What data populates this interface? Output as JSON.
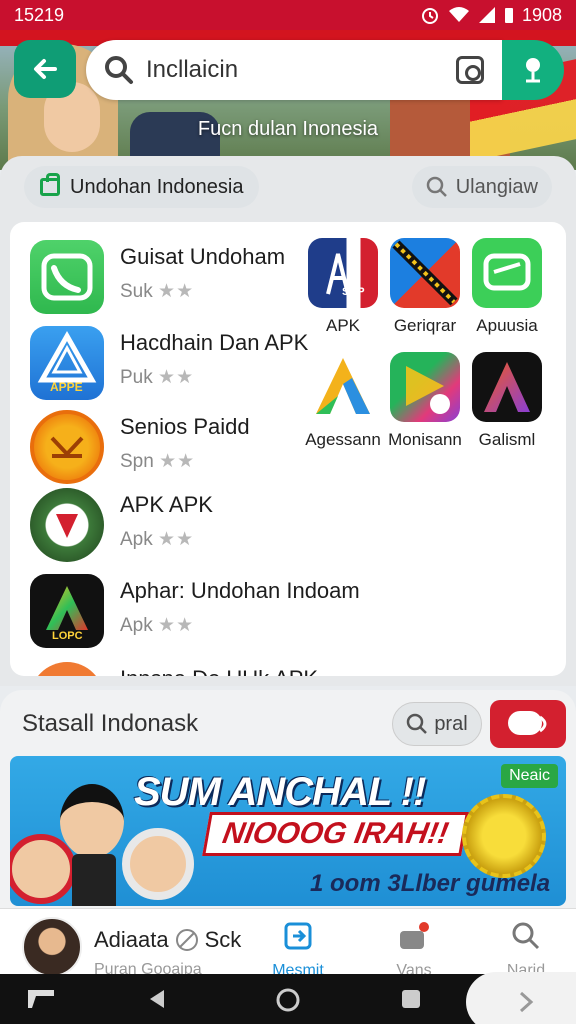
{
  "status_bar": {
    "time": "15219",
    "battery": "1908"
  },
  "header": {
    "hero_caption": "Fucn dulan Inonesia",
    "search_value": "Incllaicin"
  },
  "category_bar": {
    "chip_label": "Undohan Indonesia",
    "search_label": "Ulangiaw"
  },
  "app_list": [
    {
      "title": "Guisat Undoham",
      "sub": "Suk",
      "stars": "★★"
    },
    {
      "title": "Hacdhain Dan APK",
      "sub": "Puk",
      "stars": "★★"
    },
    {
      "title": "Senios Paidd",
      "sub": "Spn",
      "stars": "★★"
    },
    {
      "title": "APK APK",
      "sub": "Apk",
      "stars": "★★"
    },
    {
      "title": "Aphar: Undohan Indoam",
      "sub": "Apk",
      "stars": "★★"
    },
    {
      "title": "Innsna Do UUk APK",
      "sub": "",
      "stars": ""
    }
  ],
  "icon_text": {
    "app2_badge": "APPE",
    "app5_badge": "LOPC",
    "grid1_badge": "SAP"
  },
  "grid_apps": [
    {
      "label": "APK"
    },
    {
      "label": "Geriqrar"
    },
    {
      "label": "Apuusia"
    },
    {
      "label": "Agessann"
    },
    {
      "label": "Monisann"
    },
    {
      "label": "Galisml"
    }
  ],
  "section2": {
    "title": "Stasall Indonask",
    "search_label": "pral"
  },
  "banner": {
    "headline1": "SUM ANCHAL !!",
    "headline2": "NIOOOG IRAH!!",
    "headline3": "1 oom 3Llber gumela",
    "badge": "Neaic"
  },
  "bottom_nav": {
    "user_name": "Adiaata",
    "user_name2": "Sck",
    "user_sub": "Puran Gooaipa",
    "items": [
      {
        "label": "Mesmit"
      },
      {
        "label": "Vans"
      },
      {
        "label": "Narid"
      }
    ]
  },
  "colors": {
    "accent": "#0f9d75",
    "brand_red": "#c8102e",
    "nav_active": "#1a8fd8"
  }
}
